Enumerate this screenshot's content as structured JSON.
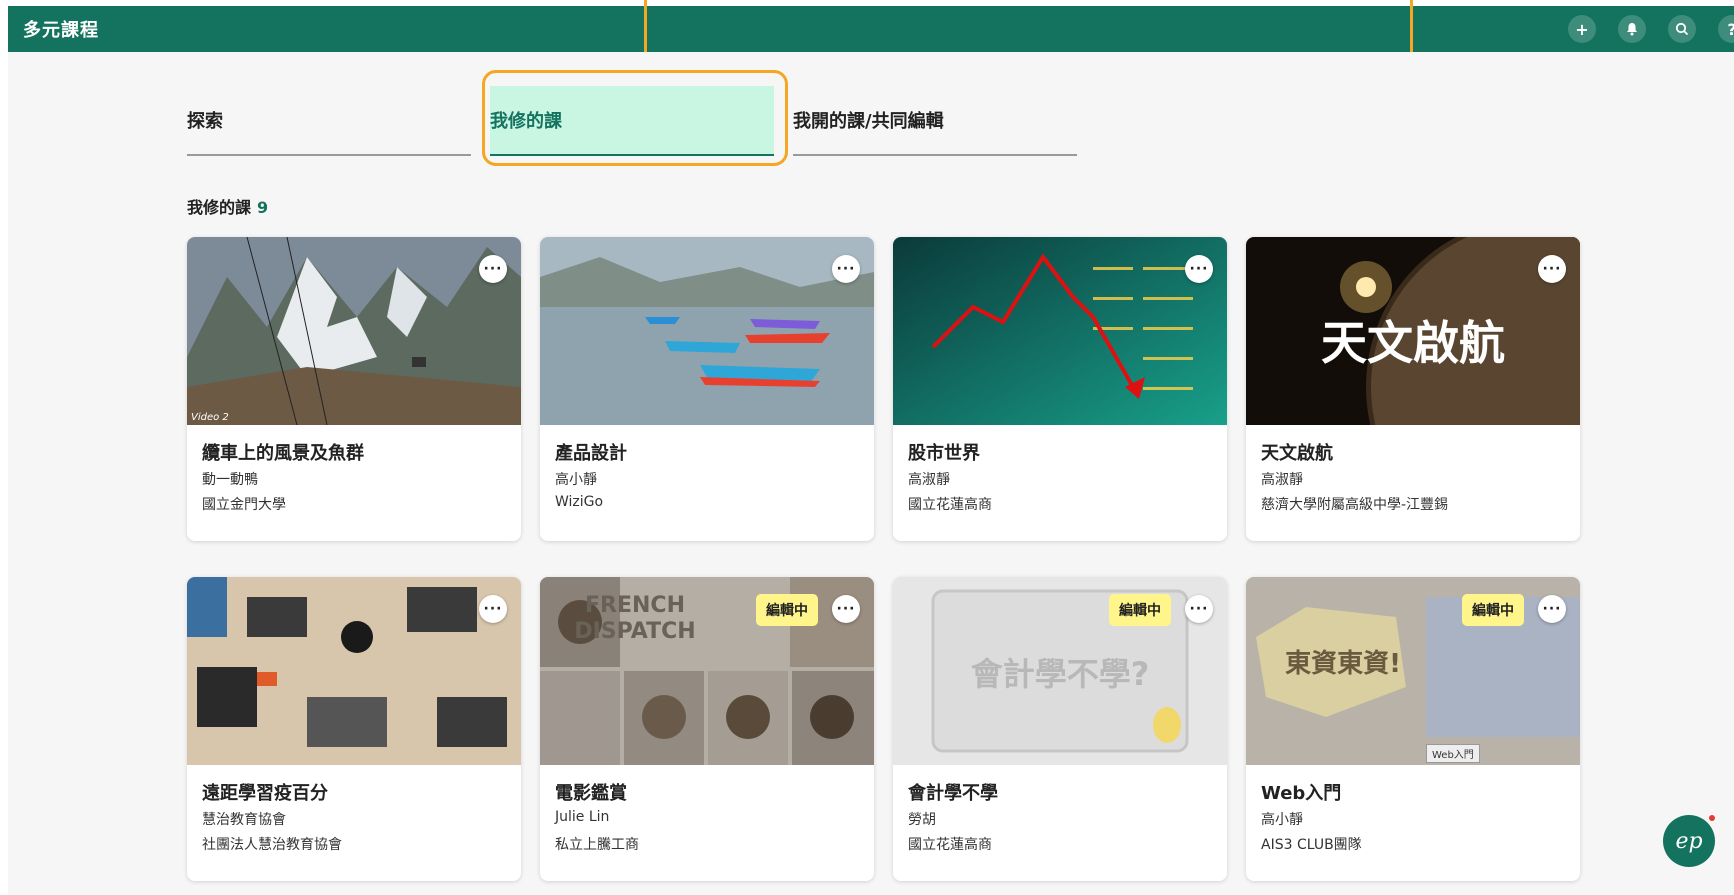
{
  "header": {
    "app_title": "多元課程",
    "icons": [
      "plus-icon",
      "bell-icon",
      "search-icon",
      "help-icon"
    ],
    "icon_glyphs": {
      "plus": "+",
      "bell": "🔔",
      "search": "⌕",
      "help": "?"
    }
  },
  "tabs": [
    {
      "label": "探索"
    },
    {
      "label": "我修的課"
    },
    {
      "label": "我開的課/共同編輯"
    }
  ],
  "section": {
    "title": "我修的課",
    "count": "9"
  },
  "more_glyph": "···",
  "cards": [
    {
      "title": "纜車上的風景及魚群",
      "teacher": "動一動鴨",
      "school": "國立金門大學",
      "caption": "Video 2"
    },
    {
      "title": "產品設計",
      "teacher": "高小靜",
      "school": "WiziGo"
    },
    {
      "title": "股市世界",
      "teacher": "高淑靜",
      "school": "國立花蓮高商"
    },
    {
      "title": "天文啟航",
      "teacher": "高淑靜",
      "school": "慈濟大學附屬高級中學-江豐錫",
      "overlay": "天文啟航"
    },
    {
      "title": "遠距學習疫百分",
      "teacher": "慧治教育協會",
      "school": "社團法人慧治教育協會"
    },
    {
      "title": "電影鑑賞",
      "teacher": "Julie Lin",
      "school": "私立上騰工商",
      "badge": "編輯中",
      "overlay": "FRENCH DISPATCH"
    },
    {
      "title": "會計學不學",
      "teacher": "勞胡",
      "school": "國立花蓮高商",
      "badge": "編輯中",
      "overlay": "會計學不學?"
    },
    {
      "title": "Web入門",
      "teacher": "高小靜",
      "school": "AIS3 CLUB團隊",
      "badge": "編輯中",
      "overlay": "東資東資!",
      "tag": "Web入門"
    }
  ],
  "fab": {
    "glyph": "ep"
  },
  "colors": {
    "brand": "#14735f",
    "accent": "#f5a623",
    "badge": "#fff58a",
    "active_tab": "#c9f5e3"
  }
}
